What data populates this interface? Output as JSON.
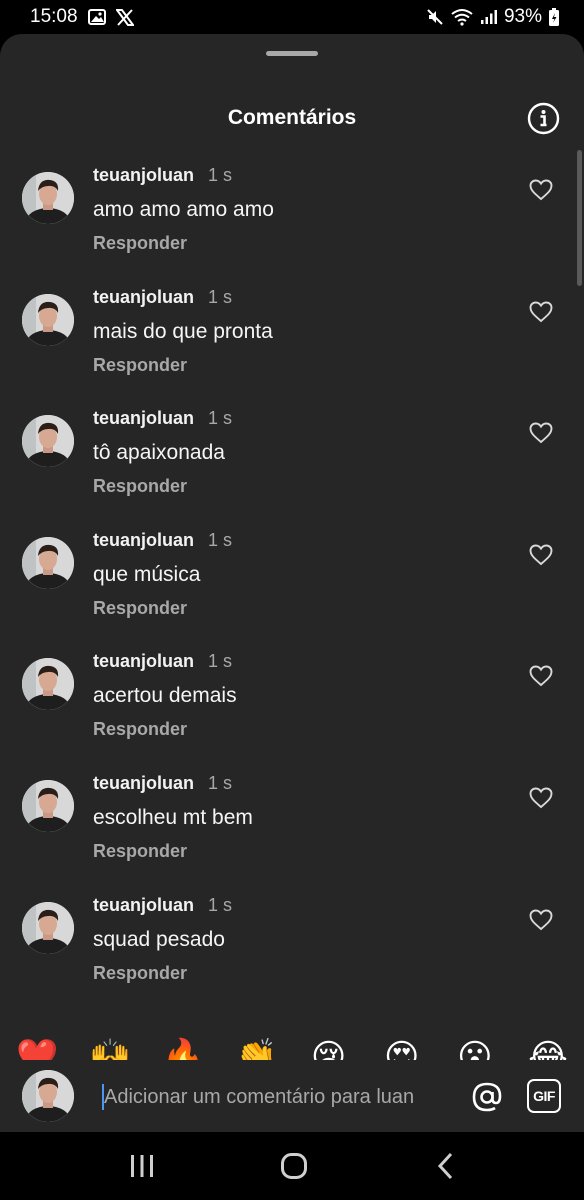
{
  "status_bar": {
    "time": "15:08",
    "left_icons": [
      "gallery-icon",
      "x-logo-icon"
    ],
    "right_icons": [
      "mute-icon",
      "wifi-icon",
      "signal-icon",
      "battery-icon"
    ],
    "battery": "93%"
  },
  "sheet": {
    "title": "Comentários",
    "info_icon": "info-icon"
  },
  "comments": [
    {
      "username": "teuanjoluan",
      "time": "1 s",
      "text": "amo amo amo amo",
      "reply_label": "Responder"
    },
    {
      "username": "teuanjoluan",
      "time": "1 s",
      "text": "mais do que pronta",
      "reply_label": "Responder"
    },
    {
      "username": "teuanjoluan",
      "time": "1 s",
      "text": "tô apaixonada",
      "reply_label": "Responder"
    },
    {
      "username": "teuanjoluan",
      "time": "1 s",
      "text": "que música",
      "reply_label": "Responder"
    },
    {
      "username": "teuanjoluan",
      "time": "1 s",
      "text": "acertou demais",
      "reply_label": "Responder"
    },
    {
      "username": "teuanjoluan",
      "time": "1 s",
      "text": "escolheu mt bem",
      "reply_label": "Responder"
    },
    {
      "username": "teuanjoluan",
      "time": "1 s",
      "text": "squad pesado",
      "reply_label": "Responder"
    }
  ],
  "emoji_bar": [
    {
      "glyph": "❤️",
      "name": "red-heart"
    },
    {
      "glyph": "🙌",
      "name": "raising-hands",
      "has_variants": true
    },
    {
      "glyph": "🔥",
      "name": "fire"
    },
    {
      "glyph": "👏",
      "name": "clapping-hands",
      "has_variants": true
    },
    {
      "glyph": "😢",
      "name": "crying-face"
    },
    {
      "glyph": "😍",
      "name": "heart-eyes"
    },
    {
      "glyph": "😮",
      "name": "face-open-mouth"
    },
    {
      "glyph": "😂",
      "name": "tears-of-joy"
    }
  ],
  "composer": {
    "placeholder": "Adicionar um comentário para luan",
    "at_icon": "at-sign-icon",
    "gif_label": "GIF"
  },
  "nav_bar": {
    "buttons": [
      "recents-icon",
      "home-icon",
      "back-icon"
    ]
  },
  "colors": {
    "sheet_bg": "#262626",
    "secondary_text": "#a8a8a8",
    "caret": "#4c95f0"
  }
}
